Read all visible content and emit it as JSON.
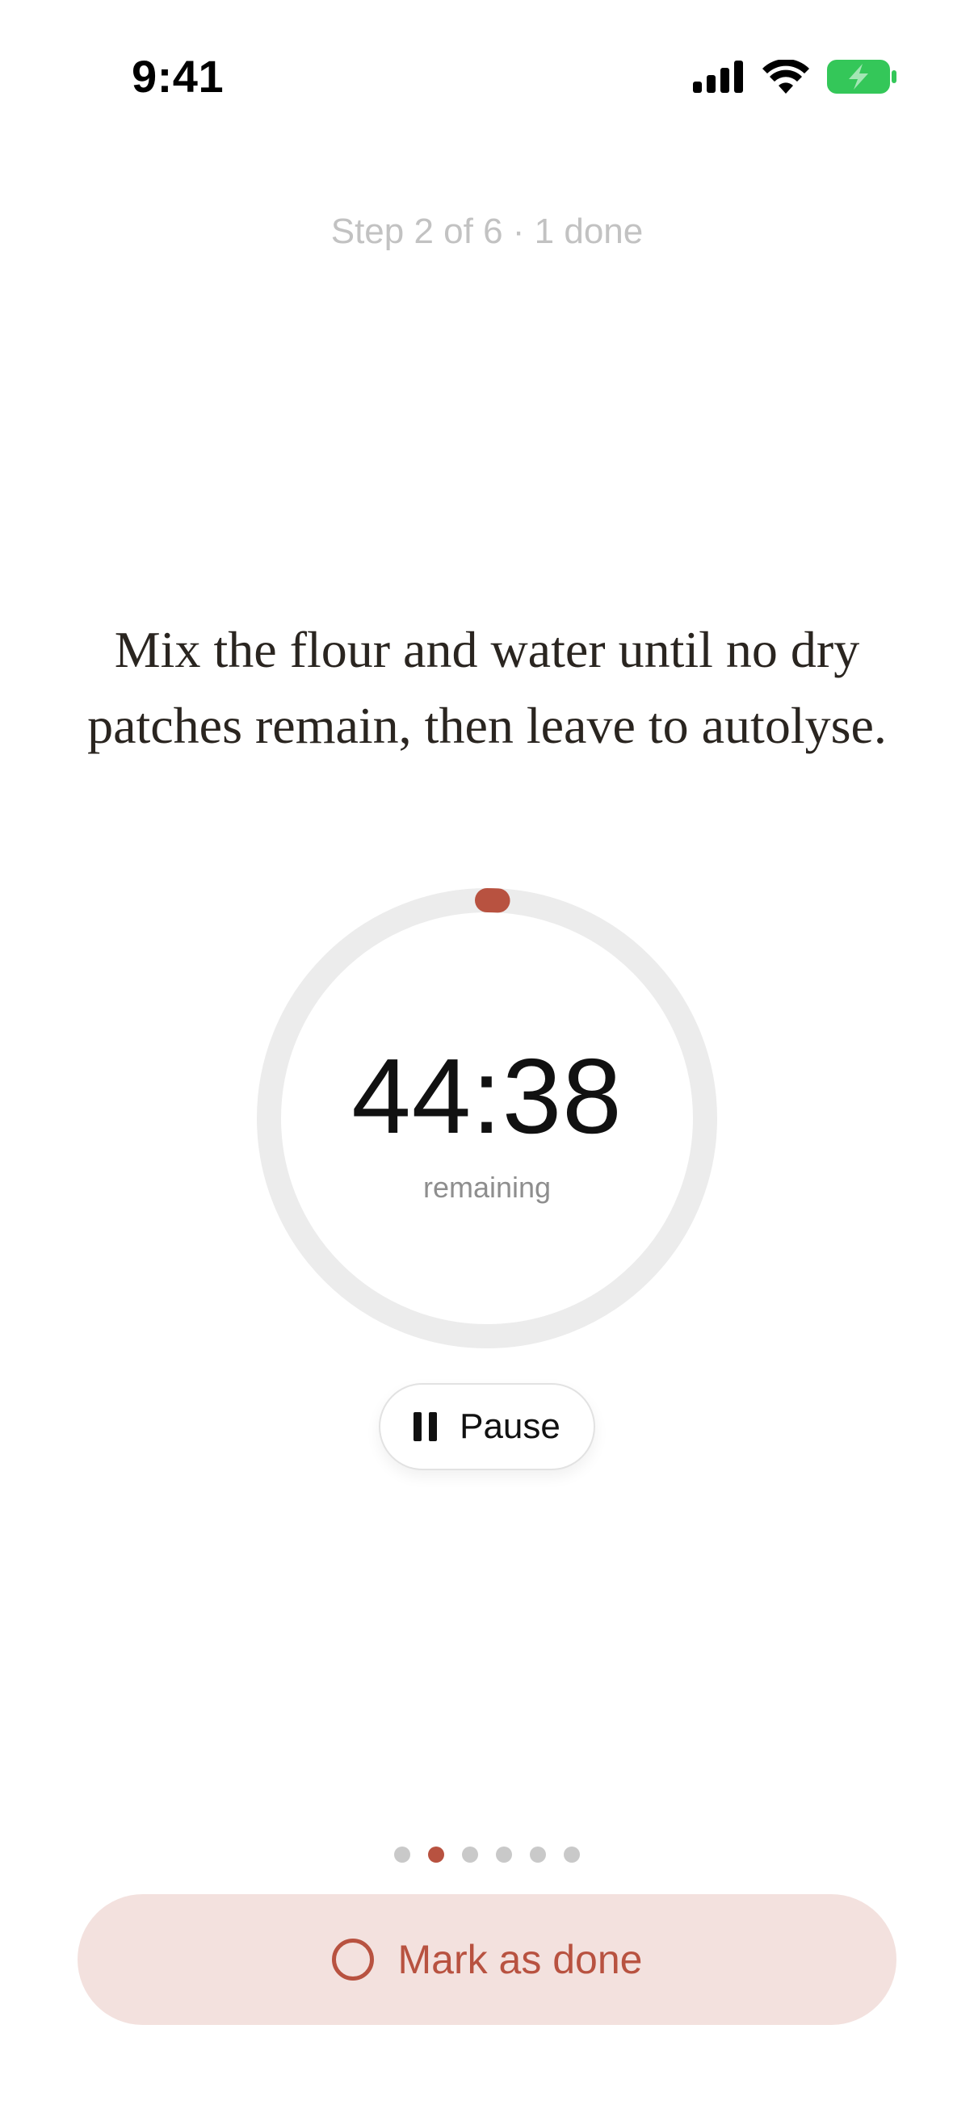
{
  "status_bar": {
    "time": "9:41",
    "icons": [
      "cellular-signal-icon",
      "wifi-icon",
      "battery-charging-icon"
    ],
    "battery_color": "#34c759"
  },
  "step": {
    "label": "Step 2 of 6 · 1 done",
    "current": 2,
    "total": 6,
    "done_count": 1
  },
  "instruction": {
    "text": "Mix the flour and water until no dry patches remain, then leave to autolyse."
  },
  "timer": {
    "value": "44:38",
    "caption": "remaining",
    "progress_fraction": 0.008,
    "accent_color": "#b85240",
    "track_color": "#ececec"
  },
  "controls": {
    "pause_label": "Pause",
    "pause_icon": "pause-icon"
  },
  "pager": {
    "count": 6,
    "active_index": 1
  },
  "mark_done": {
    "label": "Mark as done",
    "icon": "circle-outline-icon",
    "background": "#f3e1de",
    "color": "#b85240"
  }
}
